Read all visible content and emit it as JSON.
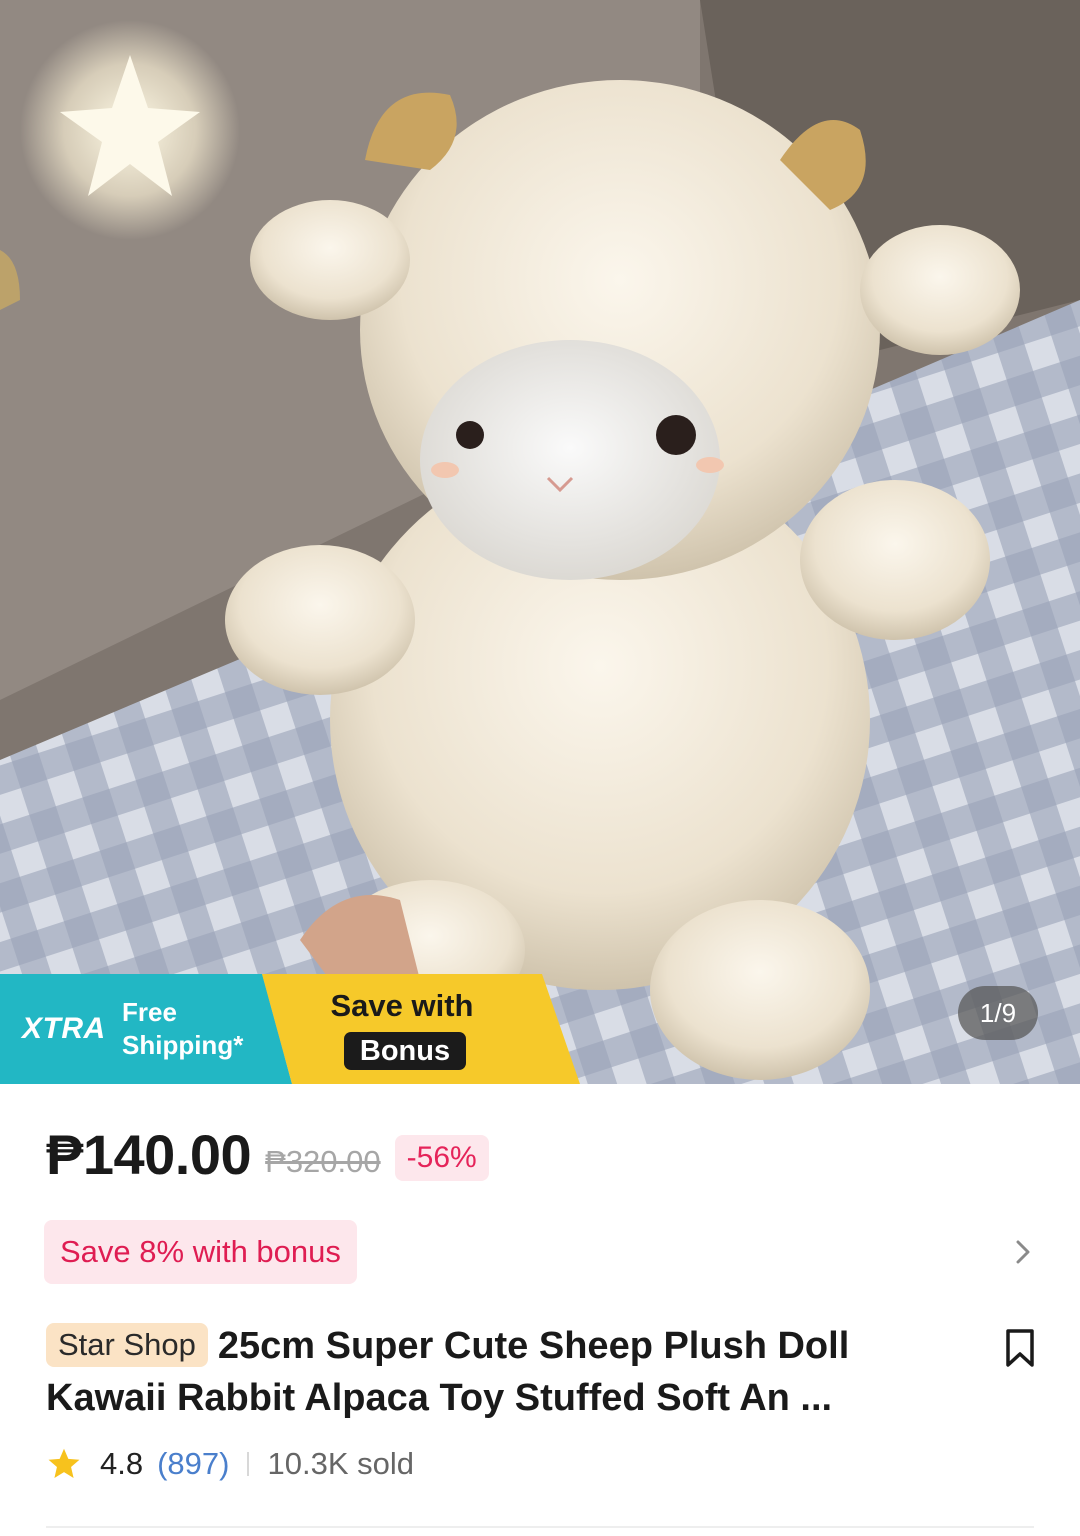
{
  "gallery": {
    "image_alt": "",
    "counter": "1/9"
  },
  "promo": {
    "xtra_label": "XTRA",
    "free_shipping_line1": "Free",
    "free_shipping_line2": "Shipping*",
    "save_with_label": "Save with",
    "bonus_label": "Bonus",
    "colors": {
      "xtra": "#22b7c4",
      "bonus": "#f6c92a"
    }
  },
  "pricing": {
    "price": "₱140.00",
    "original_price": "₱320.00",
    "discount": "-56%"
  },
  "bonus": {
    "chip_label": "Save 8% with bonus",
    "chevron_icon": "chevron-right-icon"
  },
  "product": {
    "shop_tag": "Star Shop",
    "title": "25cm Super Cute Sheep Plush Doll Kawaii Rabbit Alpaca Toy Stuffed Soft An ...",
    "bookmark_icon": "bookmark-icon"
  },
  "rating": {
    "star_icon": "star-icon",
    "value": "4.8",
    "count": "(897)",
    "sold": "10.3K sold"
  }
}
